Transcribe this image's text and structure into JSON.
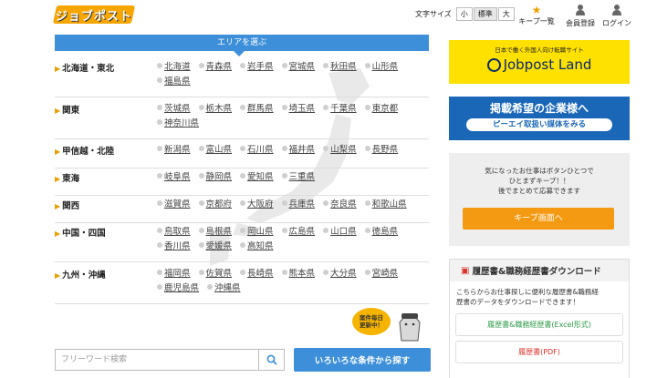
{
  "header": {
    "logo_text": "ジョブポスト",
    "font_size_label": "文字サイズ",
    "font_sizes": [
      "小",
      "標準",
      "大"
    ],
    "icons": [
      {
        "name": "star-icon",
        "label": "キープ一覧"
      },
      {
        "name": "user-icon",
        "label": "会員登録"
      },
      {
        "name": "login-icon",
        "label": "ログイン"
      }
    ]
  },
  "area": {
    "tab_label": "エリアを選ぶ",
    "regions": [
      {
        "name": "北海道・東北",
        "prefs": [
          "北海道",
          "青森県",
          "岩手県",
          "宮城県",
          "秋田県",
          "山形県",
          "福島県"
        ]
      },
      {
        "name": "関東",
        "prefs": [
          "茨城県",
          "栃木県",
          "群馬県",
          "埼玉県",
          "千葉県",
          "東京都",
          "神奈川県"
        ]
      },
      {
        "name": "甲信越・北陸",
        "prefs": [
          "新潟県",
          "富山県",
          "石川県",
          "福井県",
          "山梨県",
          "長野県"
        ]
      },
      {
        "name": "東海",
        "prefs": [
          "岐阜県",
          "静岡県",
          "愛知県",
          "三重県"
        ]
      },
      {
        "name": "関西",
        "prefs": [
          "滋賀県",
          "京都府",
          "大阪府",
          "兵庫県",
          "奈良県",
          "和歌山県"
        ]
      },
      {
        "name": "中国・四国",
        "prefs": [
          "鳥取県",
          "島根県",
          "岡山県",
          "広島県",
          "山口県",
          "徳島県",
          "香川県",
          "愛媛県",
          "高知県"
        ]
      },
      {
        "name": "九州・沖縄",
        "prefs": [
          "福岡県",
          "佐賀県",
          "長崎県",
          "熊本県",
          "大分県",
          "宮崎県",
          "鹿児島県",
          "沖縄県"
        ]
      }
    ]
  },
  "mascot": {
    "bubble_line1": "案件毎日",
    "bubble_line2": "更新中！"
  },
  "search": {
    "placeholder": "フリーワード検索",
    "conditions_button": "いろいろな条件から探す"
  },
  "sidebar": {
    "banner1_sub": "日本で働く外国人向け転職サイト",
    "banner1_main": "Jobpost Land",
    "banner2_main": "掲載希望の企業様へ",
    "banner2_pill": "ピーエイ取扱い媒体をみる",
    "keep_text_1": "気になったお仕事はボタンひとつで",
    "keep_text_2": "ひとまずキープ！！",
    "keep_text_3": "後でまとめて応募できます",
    "keep_button": "キープ画面へ",
    "download_title": "履歴書&職務経歴書ダウンロード",
    "download_desc_1": "こちらからお仕事探しに便利な履歴書&職務経",
    "download_desc_2": "歴書のデータをダウンロードできます！",
    "download_excel": "履歴書&職務経歴書(Excel形式)",
    "download_pdf": "履歴書(PDF)"
  },
  "colors": {
    "accent_blue": "#3d8fd9",
    "accent_orange": "#f39a12",
    "brand_yellow": "#ffe100",
    "navy": "#1a67b8"
  }
}
